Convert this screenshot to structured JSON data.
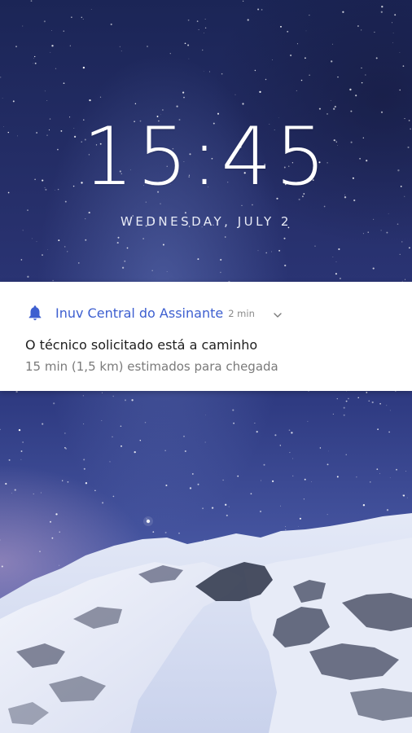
{
  "lock_screen": {
    "time": "15:45",
    "date": "WEDNESDAY, JULY 2"
  },
  "notification": {
    "app_icon": "bell-icon",
    "app_name": "Inuv Central do Assinante",
    "time_ago": "2 min",
    "expand_icon": "chevron-down-icon",
    "title": "O técnico solicitado está a caminho",
    "body": "15 min (1,5 km) estimados para chegada"
  },
  "colors": {
    "accent": "#3d5fd0",
    "notification_background": "#ffffff",
    "title_text": "#1e1e1e",
    "body_text": "#7a7a7a"
  }
}
